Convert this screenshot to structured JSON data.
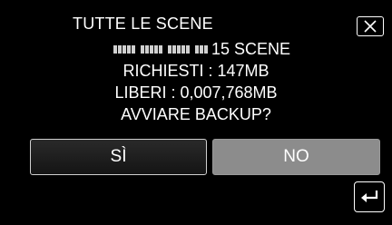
{
  "dialog": {
    "title": "TUTTE LE SCENE",
    "scene_count": "15 SCENE",
    "required": "RICHIESTI : 147MB",
    "free": "LIBERI : 0,007,768MB",
    "question": "AVVIARE BACKUP?"
  },
  "buttons": {
    "yes_label": "SÌ",
    "no_label": "NO"
  },
  "icons": {
    "close": "close-icon",
    "back": "back-return-icon",
    "progress": "progress-dots-icon"
  },
  "colors": {
    "background": "#000000",
    "no_button": "#8c8c8c",
    "text": "#ffffff"
  }
}
